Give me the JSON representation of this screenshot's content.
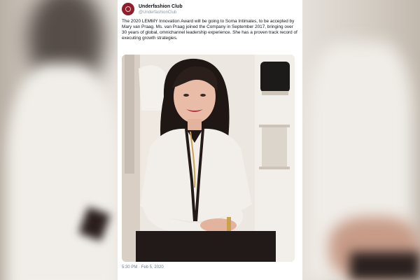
{
  "tweet": {
    "display_name": "Underfashion Club",
    "handle": "@UnderfashionClub",
    "body": "The 2020 LEMMY Innovation Award will be going to Soma Intimates, to be accepted by Mary van Praag. Ms. van Praag joined the Company in September 2017, bringing over 30 years of global, omnichannel leadership experience. She has a proven track record of executing growth strategies.",
    "timestamp": "5:30 PM · Feb 5, 2020"
  },
  "colors": {
    "avatar": "#8e1e2c",
    "jacket": "#f2efea",
    "trim": "#241a18"
  }
}
